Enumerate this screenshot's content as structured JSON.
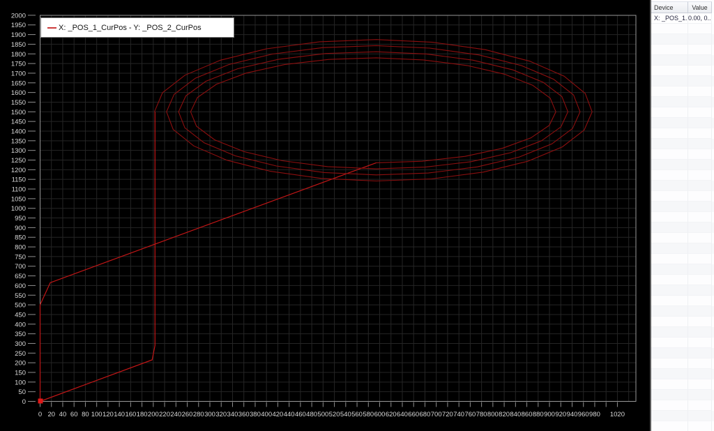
{
  "legend": {
    "label": "X: _POS_1_CurPos - Y: _POS_2_CurPos"
  },
  "panel": {
    "columns": [
      "Device",
      "Value"
    ],
    "rows": [
      {
        "device": "X: _POS_1...",
        "value": "0.00, 0..."
      }
    ],
    "empty_row_count": 39
  },
  "chart_data": {
    "type": "line",
    "title": "",
    "xlabel": "",
    "ylabel": "",
    "legend_position": "top-left",
    "legend_entries": [
      "X: _POS_1_CurPos - Y: _POS_2_CurPos"
    ],
    "grid": true,
    "x_axis": {
      "min": 0,
      "max": 1050,
      "tick_step": 20,
      "last_label": 1020,
      "missing_labels": [
        1000
      ]
    },
    "y_axis": {
      "min": 0,
      "max": 2000,
      "tick_step": 50
    },
    "series": [
      {
        "name": "X: _POS_1_CurPos - Y: _POS_2_CurPos",
        "marker_start": [
          0,
          0
        ],
        "path_segments": [
          [
            [
              0,
              0
            ],
            [
              0,
              500
            ],
            [
              18,
              615
            ],
            [
              594,
              1236
            ]
          ],
          [
            [
              203,
              1500
            ],
            [
              203,
              290
            ],
            [
              198,
              215
            ],
            [
              0,
              0
            ]
          ]
        ],
        "spiral": {
          "center": [
            594,
            1500
          ],
          "rx_start": 312,
          "rx_end": 392,
          "ry_start": 264,
          "ry_end": 382,
          "start_deg": -90,
          "total_deg": 1350,
          "deg_step": 15
        }
      }
    ],
    "colors": {
      "background": "#000000",
      "grid": "#252525",
      "axis": "#999999",
      "tick": "#8f8f8f",
      "tick_label": "#d9d9d9",
      "trace": "#c21616",
      "spiral": "#8c0f0f",
      "marker": "#e01818",
      "legend_line": "#cc3b3b"
    }
  }
}
